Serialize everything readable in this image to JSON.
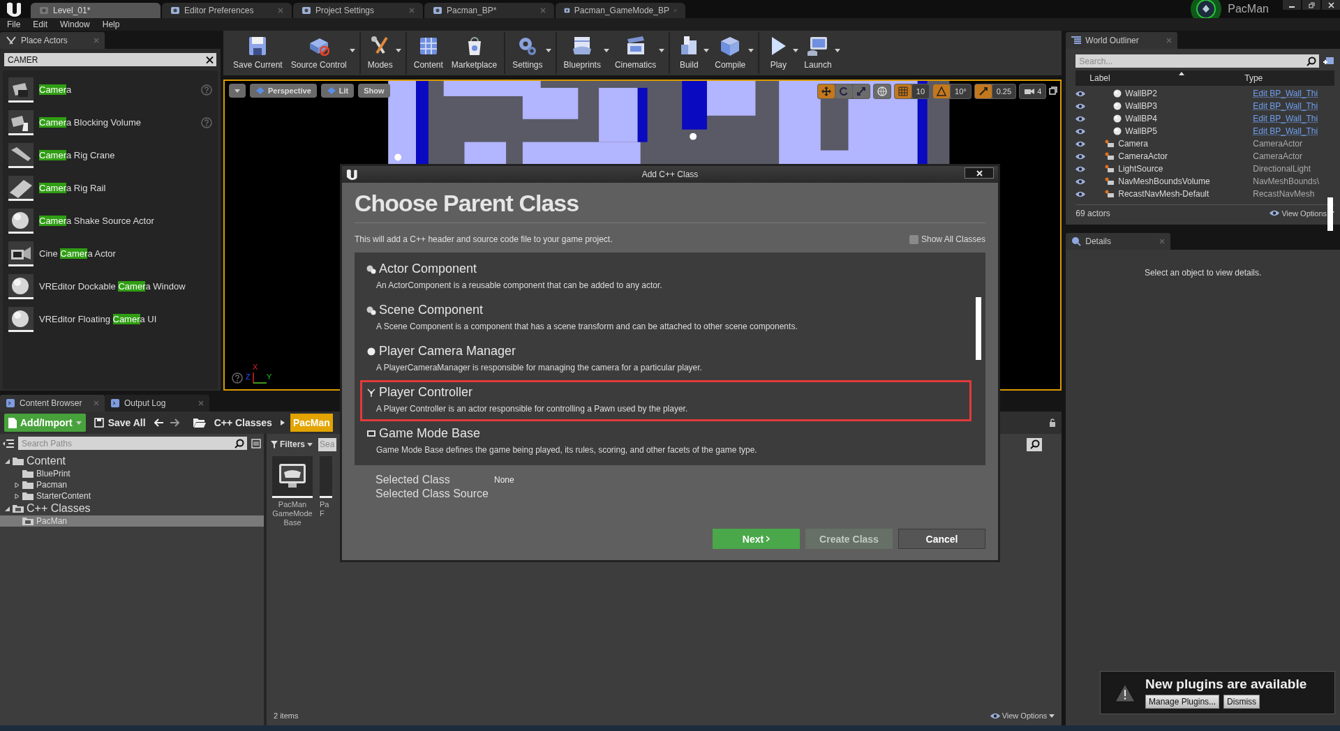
{
  "editor_tabs": [
    {
      "label": "Level_01*",
      "selected": true
    },
    {
      "label": "Editor Preferences",
      "selected": false
    },
    {
      "label": "Project Settings",
      "selected": false
    },
    {
      "label": "Pacman_BP*",
      "selected": false
    },
    {
      "label": "Pacman_GameMode_BP",
      "selected": false
    }
  ],
  "account": {
    "label": "PacMan"
  },
  "menu": [
    "File",
    "Edit",
    "Window",
    "Help"
  ],
  "place_actors": {
    "tab": "Place Actors",
    "search": {
      "value": "CAMER"
    },
    "items": [
      {
        "match": "Camer",
        "after": "a",
        "help": true
      },
      {
        "match": "Camer",
        "after": "a Blocking Volume",
        "help": true
      },
      {
        "match": "Camer",
        "after": "a Rig Crane",
        "help": false
      },
      {
        "match": "Camer",
        "after": "a Rig Rail",
        "help": false
      },
      {
        "match": "Camer",
        "after": "a Shake Source Actor",
        "help": false
      },
      {
        "before": "Cine ",
        "match": "Camer",
        "after": "a Actor",
        "help": false
      },
      {
        "before": "VREditor Dockable ",
        "match": "Camer",
        "after": "a Window",
        "help": false
      },
      {
        "before": "VREditor Floating ",
        "match": "Camer",
        "after": "a UI",
        "help": false
      }
    ]
  },
  "toolbar": [
    [
      {
        "label": "Save Current",
        "dropdown": false
      },
      {
        "label": "Source Control",
        "dropdown": true
      }
    ],
    [
      {
        "label": "Modes",
        "dropdown": true
      }
    ],
    [
      {
        "label": "Content",
        "dropdown": false
      },
      {
        "label": "Marketplace",
        "dropdown": false
      }
    ],
    [
      {
        "label": "Settings",
        "dropdown": true
      }
    ],
    [
      {
        "label": "Blueprints",
        "dropdown": true
      },
      {
        "label": "Cinematics",
        "dropdown": true
      }
    ],
    [
      {
        "label": "Build",
        "dropdown": true
      },
      {
        "label": "Compile",
        "dropdown": true
      }
    ],
    [
      {
        "label": "Play",
        "dropdown": true
      },
      {
        "label": "Launch",
        "dropdown": true
      }
    ]
  ],
  "viewport": {
    "view_buttons": [
      "Perspective",
      "Lit",
      "Show"
    ],
    "transform_tools": [
      {
        "selected": true
      },
      {
        "selected": false
      },
      {
        "selected": false
      }
    ],
    "snaps": [
      {
        "value": "10",
        "on": true
      },
      {
        "value": "10°",
        "on": true
      },
      {
        "value": "0.25",
        "on": true
      }
    ],
    "camera_speed": "4",
    "axis_labels": [
      "X",
      "Y",
      "Z"
    ]
  },
  "outliner": {
    "tab": "World Outliner",
    "search": {
      "placeholder": "Search..."
    },
    "columns": [
      "Label",
      "Type"
    ],
    "rows": [
      {
        "label": "WallBP2",
        "type": "Edit BP_Wall_Thi",
        "type_link": true
      },
      {
        "label": "WallBP3",
        "type": "Edit BP_Wall_Thi",
        "type_link": true
      },
      {
        "label": "WallBP4",
        "type": "Edit BP_Wall_Thi",
        "type_link": true
      },
      {
        "label": "WallBP5",
        "type": "Edit BP_Wall_Thi",
        "type_link": true
      },
      {
        "label": "Camera",
        "type": "CameraActor",
        "type_link": false
      },
      {
        "label": "CameraActor",
        "type": "CameraActor",
        "type_link": false
      },
      {
        "label": "LightSource",
        "type": "DirectionalLight",
        "type_link": false
      },
      {
        "label": "NavMeshBoundsVolume",
        "type": "NavMeshBounds\\",
        "type_link": false
      },
      {
        "label": "RecastNavMesh-Default",
        "type": "RecastNavMesh",
        "type_link": false
      }
    ],
    "count": "69 actors",
    "view_options": "View Options"
  },
  "details": {
    "tab": "Details",
    "message": "Select an object to view details."
  },
  "content_browser": {
    "tabs": [
      {
        "label": "Content Browser",
        "selected": true
      },
      {
        "label": "Output Log",
        "selected": false
      }
    ],
    "add_import": "Add/Import",
    "save_all": "Save All",
    "path": [
      {
        "label": "C++ Classes",
        "selected": false
      },
      {
        "label": "PacMan",
        "selected": true
      }
    ],
    "search_paths": {
      "placeholder": "Search Paths"
    },
    "tree": [
      {
        "label": "Content",
        "expanded": true,
        "selected": false,
        "children": [
          {
            "label": "BluePrint",
            "selected": false
          },
          {
            "label": "Pacman",
            "expanded": false,
            "selected": false
          },
          {
            "label": "StarterContent",
            "expanded": false,
            "selected": false
          }
        ]
      },
      {
        "label": "C++ Classes",
        "expanded": true,
        "selected": false,
        "children": [
          {
            "label": "PacMan",
            "selected": true
          }
        ]
      }
    ],
    "filters": "Filters",
    "search_assets": {
      "placeholder": "Sea"
    },
    "assets": [
      {
        "lines": [
          "PacMan",
          "GameMode",
          "Base"
        ]
      },
      {
        "lines": [
          "Pa",
          "F"
        ]
      }
    ],
    "item_count": "2 items",
    "view_options": "View Options"
  },
  "dialog": {
    "title": "Add C++ Class",
    "heading": "Choose Parent Class",
    "description": "This will add a C++ header and source code file to your game project.",
    "show_all": {
      "label": "Show All Classes",
      "checked": false
    },
    "classes": [
      {
        "name": "Actor Component",
        "description": "An ActorComponent is a reusable component that can be added to any actor.",
        "highlighted": false
      },
      {
        "name": "Scene Component",
        "description": "A Scene Component is a component that has a scene transform and can be attached to other scene components.",
        "highlighted": false
      },
      {
        "name": "Player Camera Manager",
        "description": "A PlayerCameraManager is responsible for managing the camera for a particular player.",
        "highlighted": false
      },
      {
        "name": "Player Controller",
        "description": "A Player Controller is an actor responsible for controlling a Pawn used by the player.",
        "highlighted": true
      },
      {
        "name": "Game Mode Base",
        "description": "Game Mode Base defines the game being played, its rules, scoring, and other facets of the game type.",
        "highlighted": false
      }
    ],
    "selected_class": {
      "label": "Selected Class",
      "value": "None"
    },
    "selected_source": {
      "label": "Selected Class Source"
    },
    "buttons": [
      {
        "label": "Next",
        "kind": "primary",
        "disabled": false
      },
      {
        "label": "Create Class",
        "kind": "primary",
        "disabled": true
      },
      {
        "label": "Cancel",
        "kind": "secondary",
        "disabled": false
      }
    ]
  },
  "notification": {
    "title": "New plugins are available",
    "buttons": [
      "Manage Plugins...",
      "Dismiss"
    ]
  }
}
